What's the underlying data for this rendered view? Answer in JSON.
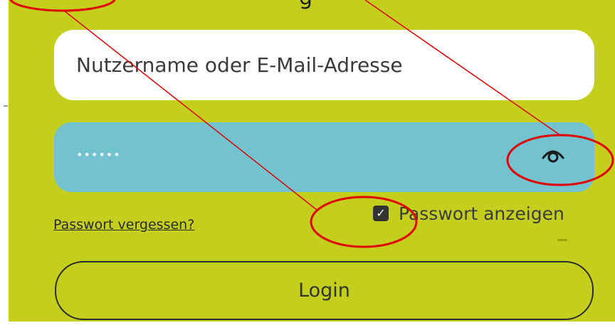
{
  "header": {
    "partial_text": "g"
  },
  "form": {
    "username_placeholder": "Nutzername oder E-Mail-Adresse",
    "password_value": "••••••",
    "forgot_password_link": "Passwort vergessen?",
    "show_password_label": "Passwort anzeigen",
    "show_password_checked": true,
    "login_button": "Login",
    "toggle_icon": "eye-icon"
  },
  "colors": {
    "background": "#c3cf1c",
    "password_field": "#72c2d0",
    "annotation": "#e00000"
  }
}
